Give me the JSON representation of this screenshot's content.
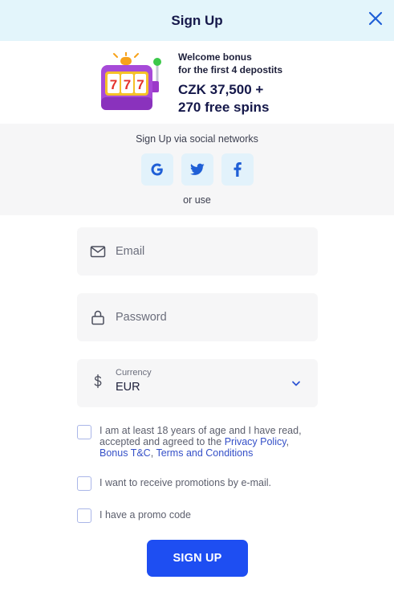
{
  "header": {
    "title": "Sign Up"
  },
  "bonus": {
    "line1": "Welcome bonus",
    "line2": "for the first 4 depostits",
    "amount": "CZK 37,500  +",
    "spins": "270 free spins",
    "slot_digits": [
      "7",
      "7",
      "7"
    ]
  },
  "social": {
    "title": "Sign Up via social networks",
    "buttons": [
      "google-icon",
      "twitter-icon",
      "facebook-icon"
    ],
    "or_use": "or use"
  },
  "form": {
    "email": {
      "placeholder": "Email",
      "value": ""
    },
    "password": {
      "placeholder": "Password",
      "value": ""
    },
    "currency": {
      "label": "Currency",
      "value": "EUR"
    }
  },
  "checkboxes": {
    "age": {
      "text_before": "I am at least 18 years of age and I have read, accepted and agreed to the ",
      "privacy_link": "Privacy Policy",
      "comma1": ",",
      "bonus_link": "Bonus T&C",
      "comma2": ", ",
      "terms_link": "Terms and Conditions",
      "checked": false
    },
    "promotions": {
      "text": "I want to receive promotions by e-mail.",
      "checked": false
    },
    "promo_code": {
      "text": "I have a promo code",
      "checked": false
    }
  },
  "submit": {
    "label": "SIGN UP"
  },
  "colors": {
    "accent": "#1e4ef2",
    "header_bg": "#e3f5fb",
    "link": "#3550c8",
    "field_bg": "#f6f6f7"
  }
}
